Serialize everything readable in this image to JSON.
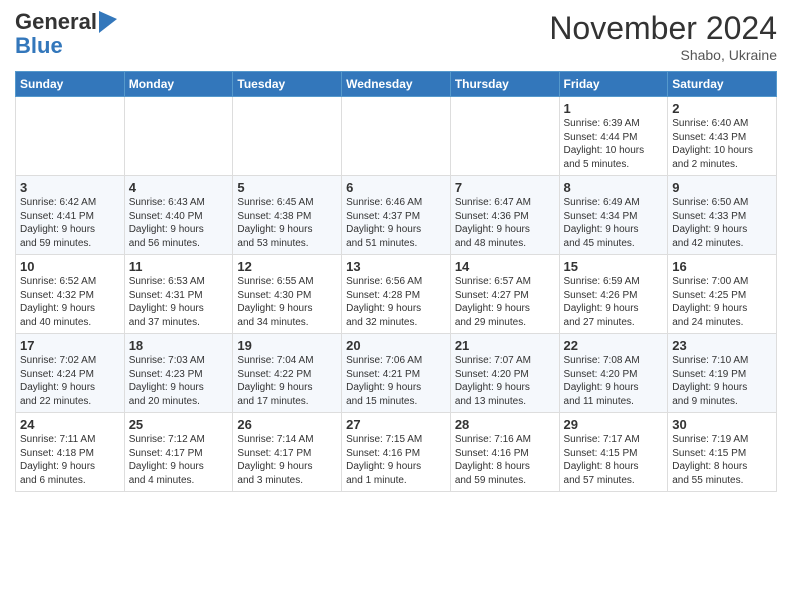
{
  "header": {
    "logo_line1": "General",
    "logo_line2": "Blue",
    "month": "November 2024",
    "location": "Shabo, Ukraine"
  },
  "weekdays": [
    "Sunday",
    "Monday",
    "Tuesday",
    "Wednesday",
    "Thursday",
    "Friday",
    "Saturday"
  ],
  "weeks": [
    [
      {
        "day": "",
        "info": ""
      },
      {
        "day": "",
        "info": ""
      },
      {
        "day": "",
        "info": ""
      },
      {
        "day": "",
        "info": ""
      },
      {
        "day": "",
        "info": ""
      },
      {
        "day": "1",
        "info": "Sunrise: 6:39 AM\nSunset: 4:44 PM\nDaylight: 10 hours\nand 5 minutes."
      },
      {
        "day": "2",
        "info": "Sunrise: 6:40 AM\nSunset: 4:43 PM\nDaylight: 10 hours\nand 2 minutes."
      }
    ],
    [
      {
        "day": "3",
        "info": "Sunrise: 6:42 AM\nSunset: 4:41 PM\nDaylight: 9 hours\nand 59 minutes."
      },
      {
        "day": "4",
        "info": "Sunrise: 6:43 AM\nSunset: 4:40 PM\nDaylight: 9 hours\nand 56 minutes."
      },
      {
        "day": "5",
        "info": "Sunrise: 6:45 AM\nSunset: 4:38 PM\nDaylight: 9 hours\nand 53 minutes."
      },
      {
        "day": "6",
        "info": "Sunrise: 6:46 AM\nSunset: 4:37 PM\nDaylight: 9 hours\nand 51 minutes."
      },
      {
        "day": "7",
        "info": "Sunrise: 6:47 AM\nSunset: 4:36 PM\nDaylight: 9 hours\nand 48 minutes."
      },
      {
        "day": "8",
        "info": "Sunrise: 6:49 AM\nSunset: 4:34 PM\nDaylight: 9 hours\nand 45 minutes."
      },
      {
        "day": "9",
        "info": "Sunrise: 6:50 AM\nSunset: 4:33 PM\nDaylight: 9 hours\nand 42 minutes."
      }
    ],
    [
      {
        "day": "10",
        "info": "Sunrise: 6:52 AM\nSunset: 4:32 PM\nDaylight: 9 hours\nand 40 minutes."
      },
      {
        "day": "11",
        "info": "Sunrise: 6:53 AM\nSunset: 4:31 PM\nDaylight: 9 hours\nand 37 minutes."
      },
      {
        "day": "12",
        "info": "Sunrise: 6:55 AM\nSunset: 4:30 PM\nDaylight: 9 hours\nand 34 minutes."
      },
      {
        "day": "13",
        "info": "Sunrise: 6:56 AM\nSunset: 4:28 PM\nDaylight: 9 hours\nand 32 minutes."
      },
      {
        "day": "14",
        "info": "Sunrise: 6:57 AM\nSunset: 4:27 PM\nDaylight: 9 hours\nand 29 minutes."
      },
      {
        "day": "15",
        "info": "Sunrise: 6:59 AM\nSunset: 4:26 PM\nDaylight: 9 hours\nand 27 minutes."
      },
      {
        "day": "16",
        "info": "Sunrise: 7:00 AM\nSunset: 4:25 PM\nDaylight: 9 hours\nand 24 minutes."
      }
    ],
    [
      {
        "day": "17",
        "info": "Sunrise: 7:02 AM\nSunset: 4:24 PM\nDaylight: 9 hours\nand 22 minutes."
      },
      {
        "day": "18",
        "info": "Sunrise: 7:03 AM\nSunset: 4:23 PM\nDaylight: 9 hours\nand 20 minutes."
      },
      {
        "day": "19",
        "info": "Sunrise: 7:04 AM\nSunset: 4:22 PM\nDaylight: 9 hours\nand 17 minutes."
      },
      {
        "day": "20",
        "info": "Sunrise: 7:06 AM\nSunset: 4:21 PM\nDaylight: 9 hours\nand 15 minutes."
      },
      {
        "day": "21",
        "info": "Sunrise: 7:07 AM\nSunset: 4:20 PM\nDaylight: 9 hours\nand 13 minutes."
      },
      {
        "day": "22",
        "info": "Sunrise: 7:08 AM\nSunset: 4:20 PM\nDaylight: 9 hours\nand 11 minutes."
      },
      {
        "day": "23",
        "info": "Sunrise: 7:10 AM\nSunset: 4:19 PM\nDaylight: 9 hours\nand 9 minutes."
      }
    ],
    [
      {
        "day": "24",
        "info": "Sunrise: 7:11 AM\nSunset: 4:18 PM\nDaylight: 9 hours\nand 6 minutes."
      },
      {
        "day": "25",
        "info": "Sunrise: 7:12 AM\nSunset: 4:17 PM\nDaylight: 9 hours\nand 4 minutes."
      },
      {
        "day": "26",
        "info": "Sunrise: 7:14 AM\nSunset: 4:17 PM\nDaylight: 9 hours\nand 3 minutes."
      },
      {
        "day": "27",
        "info": "Sunrise: 7:15 AM\nSunset: 4:16 PM\nDaylight: 9 hours\nand 1 minute."
      },
      {
        "day": "28",
        "info": "Sunrise: 7:16 AM\nSunset: 4:16 PM\nDaylight: 8 hours\nand 59 minutes."
      },
      {
        "day": "29",
        "info": "Sunrise: 7:17 AM\nSunset: 4:15 PM\nDaylight: 8 hours\nand 57 minutes."
      },
      {
        "day": "30",
        "info": "Sunrise: 7:19 AM\nSunset: 4:15 PM\nDaylight: 8 hours\nand 55 minutes."
      }
    ]
  ]
}
